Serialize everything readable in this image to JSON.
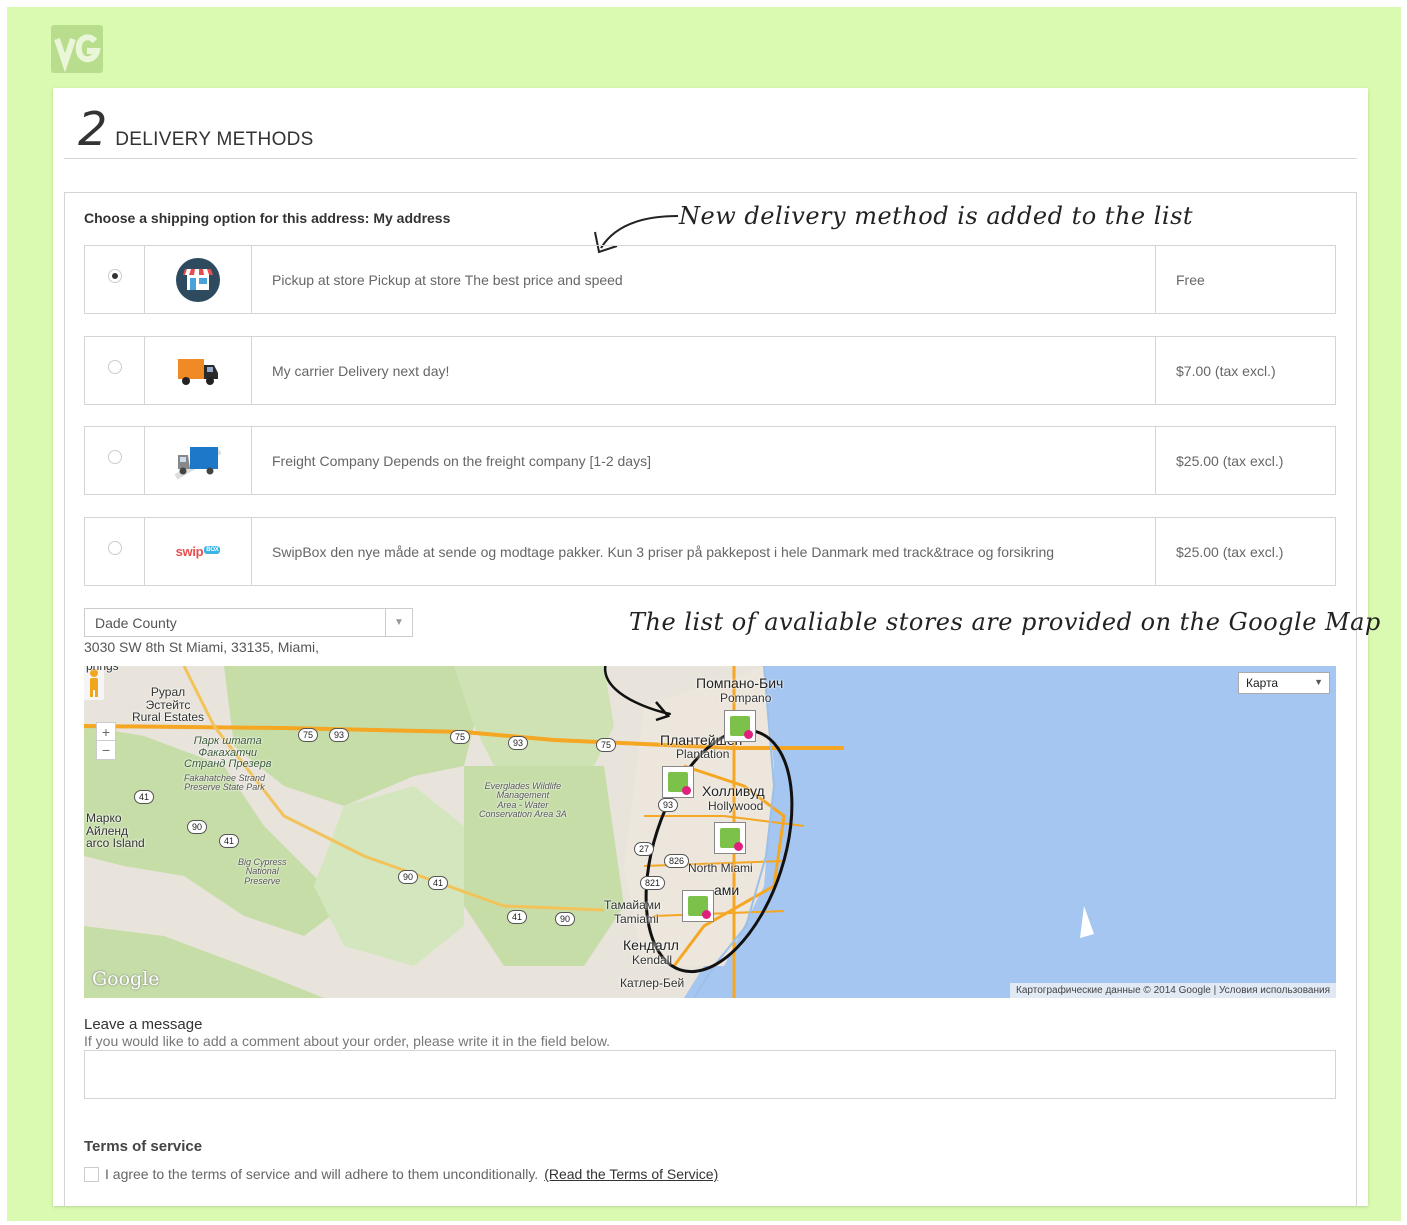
{
  "header": {
    "step_number": "2",
    "title": "DELIVERY METHODS"
  },
  "annotations": {
    "new_method": "New delivery method is added to the list",
    "map_note": "The list of avaliable stores are provided on the Google Map"
  },
  "shipping": {
    "choose_label": "Choose a shipping option for this address: My address",
    "carriers": [
      {
        "description": "Pickup at store Pickup at store The best price and speed",
        "price": "Free",
        "selected": true,
        "icon": "store-icon"
      },
      {
        "description": "My carrier Delivery next day!",
        "price": "$7.00 (tax excl.)",
        "selected": false,
        "icon": "orange-truck-icon"
      },
      {
        "description": "Freight Company Depends on the freight company [1-2 days]",
        "price": "$25.00 (tax excl.)",
        "selected": false,
        "icon": "blue-truck-icon"
      },
      {
        "description": "SwipBox den nye måde at sende og modtage pakker. Kun 3 priser på pakkepost i hele Danmark med track&trace og forsikring",
        "price": "$25.00 (tax excl.)",
        "selected": false,
        "icon": "swipbox-logo"
      }
    ],
    "swipbox_logo_text": "swip",
    "swipbox_logo_badge": "BOX"
  },
  "store_picker": {
    "selected": "Dade County",
    "address": "3030 SW 8th St Miami, 33135, Miami,"
  },
  "map": {
    "type_selector": "Карта",
    "credit": "Картографические данные © 2014 Google  |  Условия использования",
    "watermark": "Google",
    "labels": {
      "rural_estates": "Рурал\nЭстейтс\nRural Estates",
      "fakahatchee": "Парк штата\nФакахатчи\nСтранд Презерв",
      "fakahatchee_en": "Fakahatchee Strand\nPreserve State Park",
      "marco": "Марко\nАйленд\narco Island",
      "everglades": "Everglades Wildlife\nManagement\nArea - Water\nConservation Area 3A",
      "big_cypress": "Big Cypress\nNational\nPreserve",
      "pompano": "Помпано-Бич",
      "pompano_en": "Pompano",
      "plantation": "Плантейшен",
      "plantation_en": "Plantation",
      "hollywood": "Холливуд",
      "hollywood_en": "Hollywood",
      "north_miami": "North Miami",
      "tamiami": "Тамайами",
      "tamiami_en": "Tamiami",
      "kendall": "Кендалл",
      "kendall_en": "Kendall",
      "cutler": "Катлер-Бей",
      "miami": "ами",
      "springs": "prings"
    },
    "road_shields": [
      "75",
      "93",
      "75",
      "93",
      "75",
      "41",
      "90",
      "41",
      "90",
      "41",
      "41",
      "90",
      "93",
      "27",
      "826",
      "821"
    ]
  },
  "message": {
    "title": "Leave a message",
    "help": "If you would like to add a comment about your order, please write it in the field below.",
    "value": ""
  },
  "terms": {
    "title": "Terms of service",
    "agree": "I agree to the terms of service and will adhere to them unconditionally.",
    "link": "(Read the Terms of Service)"
  },
  "colors": {
    "frame_bg": "#d9fab0",
    "water": "#a4c6f0",
    "land": "#e8e4dc",
    "park": "#c6dda8",
    "road": "#f5a623"
  }
}
